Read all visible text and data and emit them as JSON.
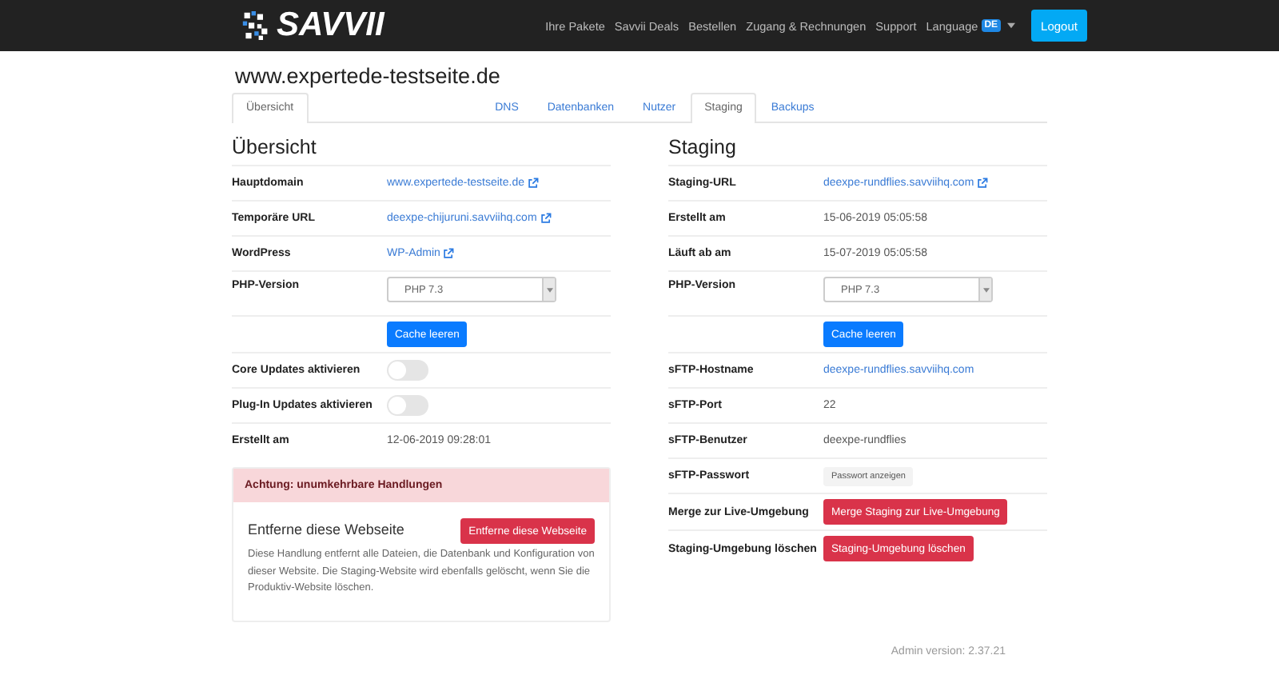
{
  "navbar": {
    "brand": "SAVVII",
    "links": [
      "Ihre Pakete",
      "Savvii Deals",
      "Bestellen",
      "Zugang & Rechnungen",
      "Support"
    ],
    "language": {
      "label": "Language",
      "badge": "DE"
    },
    "logout": "Logout"
  },
  "site_title": "www.expertede-testseite.de",
  "tabs": [
    {
      "label": "Übersicht",
      "selected": true
    },
    {
      "label": "DNS",
      "selected": false
    },
    {
      "label": "Datenbanken",
      "selected": false
    },
    {
      "label": "Nutzer",
      "selected": false
    },
    {
      "label": "Staging",
      "selected": true
    },
    {
      "label": "Backups",
      "selected": false
    }
  ],
  "overview": {
    "heading": "Übersicht",
    "rows": [
      {
        "kind": "link",
        "label": "Hauptdomain",
        "value": "www.expertede-testseite.de",
        "external": true
      },
      {
        "kind": "link",
        "label": "Temporäre URL",
        "value": "deexpe-chijuruni.savviihq.com",
        "external": true
      },
      {
        "kind": "link",
        "label": "WordPress",
        "value": "WP-Admin",
        "external": true
      },
      {
        "kind": "select",
        "label": "PHP-Version",
        "value": "PHP 7.3"
      },
      {
        "kind": "button",
        "value": "Cache leeren"
      },
      {
        "kind": "toggle",
        "label": "Core Updates aktivieren",
        "on": false
      },
      {
        "kind": "toggle",
        "label": "Plug-In Updates aktivieren",
        "on": false
      },
      {
        "kind": "text",
        "label": "Erstellt am",
        "value": "12-06-2019 09:28:01"
      }
    ]
  },
  "danger": {
    "header": "Achtung: unumkehrbare Handlungen",
    "title": "Entferne diese Webseite",
    "button": "Entferne diese Webseite",
    "text": "Diese Handlung entfernt alle Dateien, die Datenbank und Konfiguration von dieser Website. Die Staging-Website wird ebenfalls gelöscht, wenn Sie die Produktiv-Website löschen."
  },
  "staging": {
    "heading": "Staging",
    "rows": [
      {
        "kind": "link",
        "label": "Staging-URL",
        "value": "deexpe-rundflies.savviihq.com",
        "external": true
      },
      {
        "kind": "text",
        "label": "Erstellt am",
        "value": "15-06-2019 05:05:58"
      },
      {
        "kind": "text",
        "label": "Läuft ab am",
        "value": "15-07-2019 05:05:58"
      },
      {
        "kind": "select",
        "label": "PHP-Version",
        "value": "PHP 7.3"
      },
      {
        "kind": "button",
        "value": "Cache leeren"
      },
      {
        "kind": "link",
        "label": "sFTP-Hostname",
        "value": "deexpe-rundflies.savviihq.com",
        "external": false
      },
      {
        "kind": "text",
        "label": "sFTP-Port",
        "value": "22"
      },
      {
        "kind": "text",
        "label": "sFTP-Benutzer",
        "value": "deexpe-rundflies"
      },
      {
        "kind": "small-button",
        "label": "sFTP-Passwort",
        "value": "Passwort anzeigen"
      },
      {
        "kind": "danger-button",
        "label": "Merge zur Live-Umgebung",
        "value": "Merge Staging zur Live-Umgebung"
      },
      {
        "kind": "danger-button",
        "label": "Staging-Umgebung löschen",
        "value": "Staging-Umgebung löschen"
      }
    ]
  },
  "admin_version": "Admin version: 2.37.21"
}
